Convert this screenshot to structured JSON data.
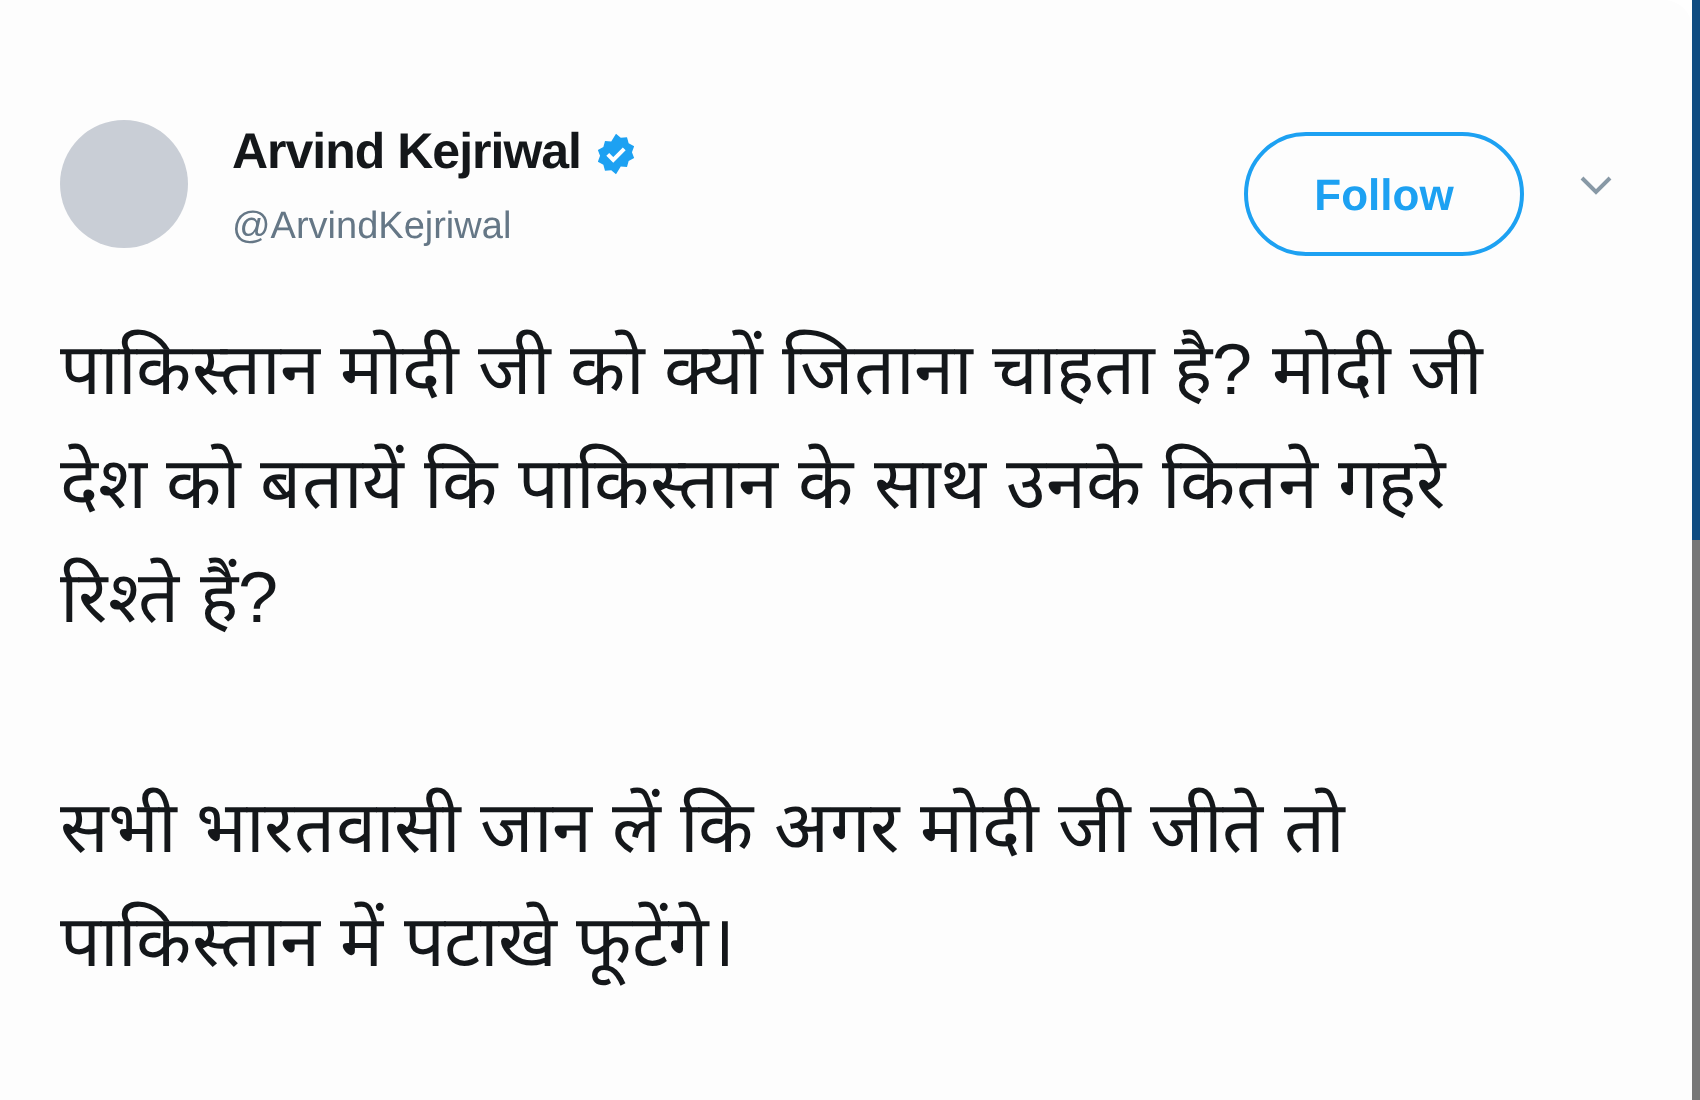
{
  "author": {
    "name": "Arvind Kejriwal",
    "verified": true,
    "handle": "@ArvindKejriwal"
  },
  "follow_button": {
    "label": "Follow"
  },
  "paragraphs": [
    "पाकिस्तान मोदी जी को क्यों जिताना चाहता है? मोदी जी देश को बतायें कि पाकिस्तान के साथ उनके कितने गहरे रिश्ते हैं?",
    "सभी भारतवासी जान लें कि अगर मोदी जी जीते तो पाकिस्तान में पटाखे फूटेंगे।"
  ]
}
